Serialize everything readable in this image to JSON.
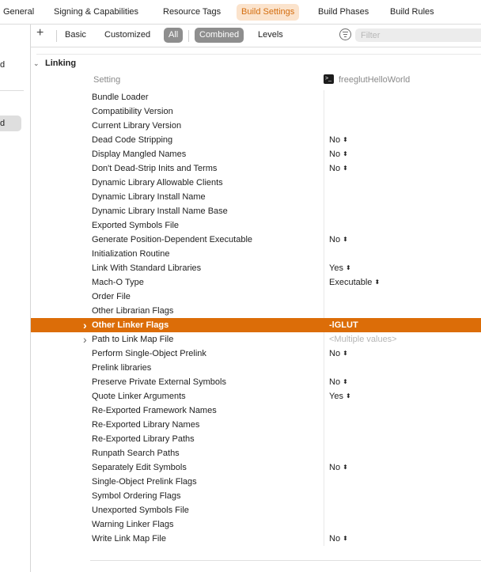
{
  "tabs": [
    {
      "label": "General",
      "active": false
    },
    {
      "label": "Signing & Capabilities",
      "active": false
    },
    {
      "label": "Resource Tags",
      "active": false
    },
    {
      "label": "Build Settings",
      "active": true
    },
    {
      "label": "Build Phases",
      "active": false
    },
    {
      "label": "Build Rules",
      "active": false
    }
  ],
  "sidebar": {
    "item1": "d",
    "item2": "d"
  },
  "filterbar": {
    "add": "+",
    "basic": "Basic",
    "customized": "Customized",
    "all": "All",
    "combined": "Combined",
    "levels": "Levels",
    "filter_placeholder": "Filter"
  },
  "section": {
    "title": "Linking",
    "setting_header": "Setting",
    "target_header": "freeglutHelloWorld"
  },
  "rows": [
    {
      "name": "Bundle Loader",
      "value": ""
    },
    {
      "name": "Compatibility Version",
      "value": ""
    },
    {
      "name": "Current Library Version",
      "value": ""
    },
    {
      "name": "Dead Code Stripping",
      "value": "No"
    },
    {
      "name": "Display Mangled Names",
      "value": "No"
    },
    {
      "name": "Don't Dead-Strip Inits and Terms",
      "value": "No"
    },
    {
      "name": "Dynamic Library Allowable Clients",
      "value": ""
    },
    {
      "name": "Dynamic Library Install Name",
      "value": ""
    },
    {
      "name": "Dynamic Library Install Name Base",
      "value": ""
    },
    {
      "name": "Exported Symbols File",
      "value": ""
    },
    {
      "name": "Generate Position-Dependent Executable",
      "value": "No"
    },
    {
      "name": "Initialization Routine",
      "value": ""
    },
    {
      "name": "Link With Standard Libraries",
      "value": "Yes"
    },
    {
      "name": "Mach-O Type",
      "value": "Executable"
    },
    {
      "name": "Order File",
      "value": ""
    },
    {
      "name": "Other Librarian Flags",
      "value": ""
    },
    {
      "name": "Other Linker Flags",
      "value": "-lGLUT"
    },
    {
      "name": "Path to Link Map File",
      "value": "<Multiple values>"
    },
    {
      "name": "Perform Single-Object Prelink",
      "value": "No"
    },
    {
      "name": "Prelink libraries",
      "value": ""
    },
    {
      "name": "Preserve Private External Symbols",
      "value": "No"
    },
    {
      "name": "Quote Linker Arguments",
      "value": "Yes"
    },
    {
      "name": "Re-Exported Framework Names",
      "value": ""
    },
    {
      "name": "Re-Exported Library Names",
      "value": ""
    },
    {
      "name": "Re-Exported Library Paths",
      "value": ""
    },
    {
      "name": "Runpath Search Paths",
      "value": ""
    },
    {
      "name": "Separately Edit Symbols",
      "value": "No"
    },
    {
      "name": "Single-Object Prelink Flags",
      "value": ""
    },
    {
      "name": "Symbol Ordering Flags",
      "value": ""
    },
    {
      "name": "Unexported Symbols File",
      "value": ""
    },
    {
      "name": "Warning Linker Flags",
      "value": ""
    },
    {
      "name": "Write Link Map File",
      "value": "No"
    }
  ],
  "colors": {
    "accent": "#dc6d08",
    "active_tab_bg": "#fbe3cc",
    "active_tab_text": "#d46e0f"
  }
}
